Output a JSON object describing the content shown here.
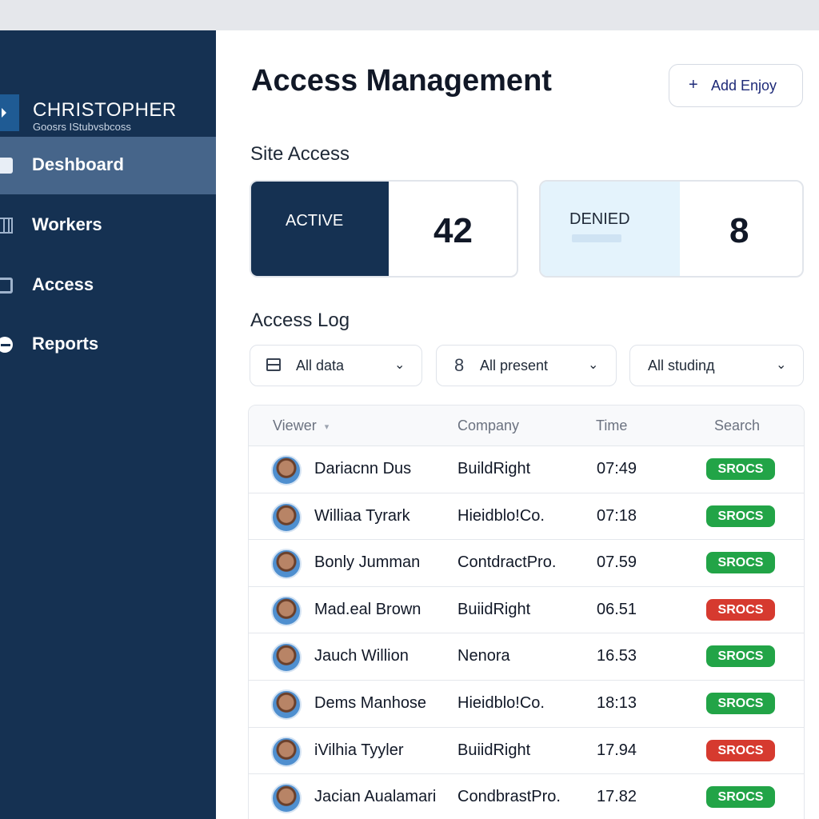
{
  "brand": {
    "name": "CHRISTOPHER",
    "subtitle": "Goosrs IStubvsbcoss"
  },
  "nav": [
    {
      "label": "Deshboard",
      "icon": "dashboard-icon",
      "active": true
    },
    {
      "label": "Workers",
      "icon": "workers-icon",
      "active": false
    },
    {
      "label": "Access",
      "icon": "access-icon",
      "active": false
    },
    {
      "label": "Reports",
      "icon": "reports-icon",
      "active": false
    }
  ],
  "header": {
    "title": "Access Management",
    "add_button_icon": "+",
    "add_button_label": "Add Enjoy"
  },
  "site_access": {
    "heading": "Site Access",
    "active": {
      "label": "ACTIVE",
      "value": "42"
    },
    "denied": {
      "label": "DENIED",
      "value": "8"
    }
  },
  "access_log": {
    "heading": "Access Log",
    "filters": [
      {
        "icon": "table-icon",
        "label": "All data"
      },
      {
        "icon": "8",
        "label": "All present"
      },
      {
        "icon": "",
        "label": "All studinд"
      }
    ],
    "columns": [
      "Viewer",
      "Company",
      "Time",
      "Search"
    ],
    "sort_indicator": "▾",
    "rows": [
      {
        "name": "Dariacnn Dus",
        "company": "BuildRight",
        "time": "07:49",
        "status": "SROCS",
        "status_color": "#22a447"
      },
      {
        "name": "Williaa Tyrark",
        "company": "Hieidblo!Co.",
        "time": "07:18",
        "status": "SROCS",
        "status_color": "#22a447"
      },
      {
        "name": "Bonly Jumman",
        "company": "ContdractPro.",
        "time": "07.59",
        "status": "SROCS",
        "status_color": "#22a447"
      },
      {
        "name": "Mad.eal Brown",
        "company": "BuiidRight",
        "time": "06.51",
        "status": "SROCS",
        "status_color": "#d63a2f"
      },
      {
        "name": "Jauch Willion",
        "company": "Nenora",
        "time": "16.53",
        "status": "SROCS",
        "status_color": "#22a447"
      },
      {
        "name": "Dems Manhose",
        "company": "Hieidblo!Co.",
        "time": "18:13",
        "status": "SROCS",
        "status_color": "#22a447"
      },
      {
        "name": "іVilhia Tyyler",
        "company": "BuiidRight",
        "time": "17.94",
        "status": "SROCS",
        "status_color": "#d63a2f"
      },
      {
        "name": "Jacian Aualamari",
        "company": "CondbrastPro.",
        "time": "17.82",
        "status": "SROCS",
        "status_color": "#22a447"
      }
    ]
  },
  "colors": {
    "sidebar": "#153152",
    "active_nav": "#46658a",
    "active_card": "#153152",
    "denied_card": "#e4f3fc",
    "success": "#22a447",
    "danger": "#d63a2f"
  }
}
